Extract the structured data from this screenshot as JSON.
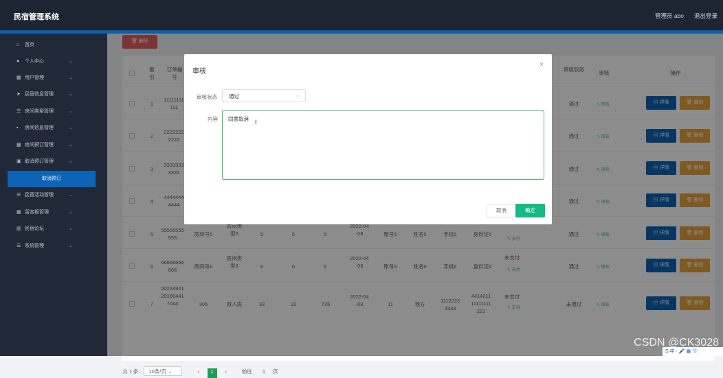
{
  "app": {
    "title": "民宿管理系统",
    "admin": "管理员 abo",
    "logout": "退出登录"
  },
  "sidebar": {
    "items": [
      {
        "label": "首页",
        "icon": "home-icon",
        "glyph": "⌂"
      },
      {
        "label": "个人中心",
        "icon": "user-icon",
        "glyph": "●"
      },
      {
        "label": "用户管理",
        "icon": "grid-icon",
        "glyph": "▦"
      },
      {
        "label": "民宿信息管理",
        "icon": "send-icon",
        "glyph": "➤"
      },
      {
        "label": "房间类型管理",
        "icon": "list-icon",
        "glyph": "☰"
      },
      {
        "label": "房间信息管理",
        "icon": "chat-icon",
        "glyph": "▪"
      },
      {
        "label": "房间预订管理",
        "icon": "grid-icon",
        "glyph": "▦"
      },
      {
        "label": "取消预订管理",
        "icon": "camera-icon",
        "glyph": "▣"
      },
      {
        "label": "民宿活动管理",
        "icon": "list-icon",
        "glyph": "☰"
      },
      {
        "label": "留言板管理",
        "icon": "grid-icon",
        "glyph": "▦"
      },
      {
        "label": "民宿论坛",
        "icon": "chart-icon",
        "glyph": "▥"
      },
      {
        "label": "系统管理",
        "icon": "list-icon",
        "glyph": "☰"
      }
    ],
    "active_sub": "取消预订"
  },
  "toolbar": {
    "delete_label": "删除"
  },
  "table": {
    "headers": {
      "index": "索引",
      "order": "订单编号",
      "audit_status": "审核状态",
      "audit": "审核",
      "actions": "操作"
    },
    "rows": [
      {
        "index": "1",
        "order": "11111111111",
        "status": "通过"
      },
      {
        "index": "2",
        "order": "22222222222",
        "status": "通过"
      },
      {
        "index": "3",
        "order": "33333333333",
        "status": "通过"
      },
      {
        "index": "4",
        "order": "44444444444",
        "status": "通过"
      },
      {
        "index": "5",
        "order": "55555555555",
        "room_no": "房间号5",
        "room_type": "房间类型5",
        "c1": "5",
        "c2": "5",
        "c3": "5",
        "date": "2022-04-08",
        "acct": "账号5",
        "name": "姓名5",
        "phone": "手机5",
        "id": "身份证5",
        "pay": "支付",
        "status": "通过"
      },
      {
        "index": "6",
        "order": "66666666666",
        "room_no": "房间号6",
        "room_type": "房间类型6",
        "c1": "6",
        "c2": "6",
        "c3": "6",
        "date": "2022-04-08",
        "acct": "账号6",
        "name": "姓名6",
        "phone": "手机6",
        "id": "身份证6",
        "paystate": "未支付",
        "pay": "支付",
        "status": "通过"
      },
      {
        "index": "7",
        "order": "20224821201664417044",
        "room_no": "305",
        "room_type": "双人房",
        "c1": "33",
        "c2": "22",
        "c3": "726",
        "date": "2022-04-08",
        "acct": "11",
        "name": "地方",
        "phone": "11122233333",
        "id": "441421111111111221",
        "paystate": "未支付",
        "pay": "支付",
        "status": "未通过"
      }
    ],
    "detail_label": "详情",
    "delete_label": "删除",
    "audit_link": "审核"
  },
  "pager": {
    "total": "共 7 条",
    "per_page": "10条/页",
    "current": "1",
    "goto": "前往",
    "goto_page": "1",
    "page_suffix": "页"
  },
  "dialog": {
    "title": "审核",
    "status_label": "审核状态",
    "status_value": "通过",
    "content_label": "内容",
    "content_value": "同意取消",
    "cancel_label": "取消",
    "ok_label": "确定"
  },
  "watermark": "CSDN @CK3028",
  "tray": "S 中 · 🎤 ▦ 👕"
}
